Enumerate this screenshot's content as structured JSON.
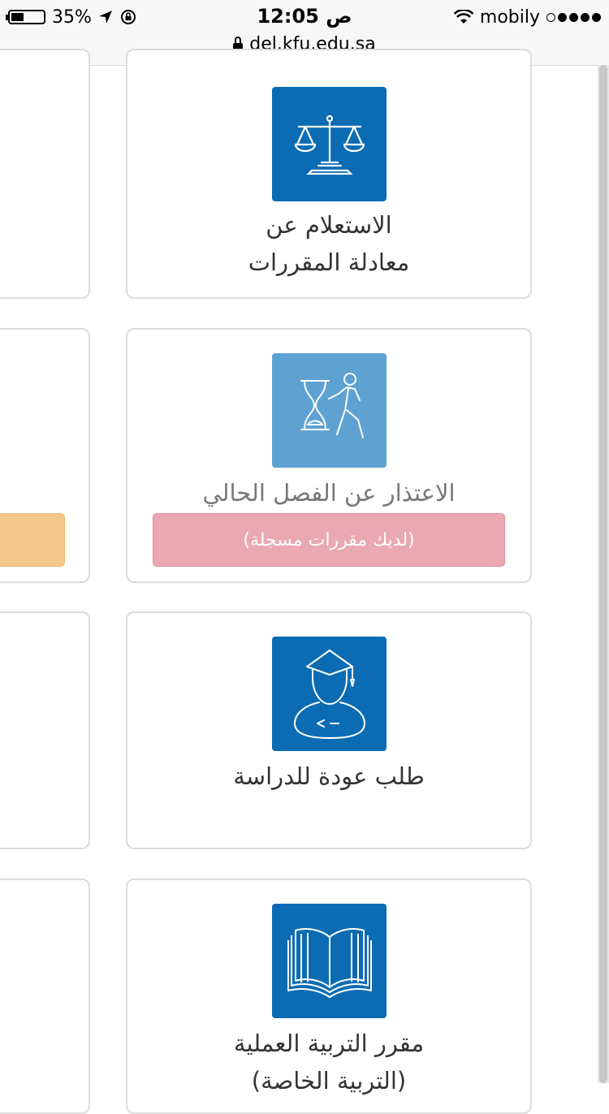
{
  "status_bar": {
    "battery_percent": "35%",
    "time": "12:05 ص",
    "carrier": "mobily",
    "signal_bars": 4,
    "url": "del.kfu.edu.sa"
  },
  "cards": [
    {
      "icon": "scales-icon",
      "title_line1": "الاستعلام عن",
      "title_line2": "معادلة المقررات",
      "disabled": false
    },
    {
      "icon": "hourglass-person-icon",
      "title_line1": "الاعتذار عن الفصل الحالي",
      "notice": "(لديك مقررات مسجلة)",
      "disabled": true
    },
    {
      "icon": "graduate-icon",
      "title_line1": "طلب عودة للدراسة",
      "disabled": false
    },
    {
      "icon": "open-book-icon",
      "title_line1": "مقرر التربية العملية",
      "title_line2": "(التربية الخاصة)",
      "disabled": false
    }
  ],
  "colors": {
    "icon_blue": "#0b6cb4",
    "icon_blue_disabled": "#5ea2d3",
    "notice_pink": "#eaa8b1",
    "orange": "#f5c98d"
  }
}
